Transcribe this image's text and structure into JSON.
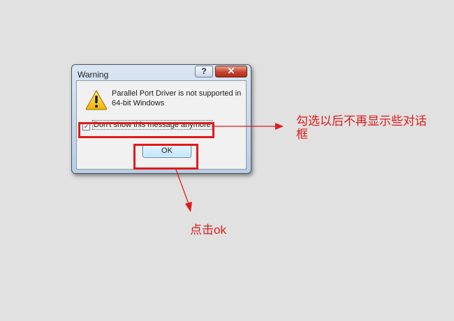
{
  "dialog": {
    "title": "Warning",
    "help_label": "?",
    "close_label": "✕",
    "message_lines": [
      "Parallel Port Driver is not supported in",
      "64-bit Windows"
    ],
    "checkbox": {
      "checked": true,
      "check_glyph": "✓",
      "label": "Don't show this message anymore"
    },
    "ok_label": "OK",
    "icon": "warning-icon"
  },
  "annotations": {
    "checkbox_note_lines": [
      "勾选以后不再显示些对话",
      "框"
    ],
    "ok_note": "点击ok",
    "color": "#e01b1b"
  }
}
